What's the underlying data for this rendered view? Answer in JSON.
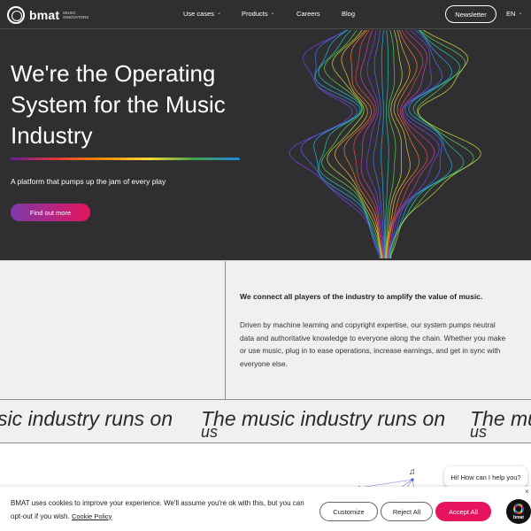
{
  "header": {
    "logo_text": "bmat",
    "logo_sub": "MUSIC INNOVATORS",
    "nav": [
      {
        "label": "Use cases",
        "dropdown": true
      },
      {
        "label": "Products",
        "dropdown": true
      },
      {
        "label": "Careers",
        "dropdown": false
      },
      {
        "label": "Blog",
        "dropdown": false
      }
    ],
    "newsletter_label": "Newsletter",
    "language": "EN"
  },
  "hero": {
    "title": "We're the Operating System for the Music Industry",
    "subtitle": "A platform that pumps up the jam of every play",
    "cta_label": "Find out more"
  },
  "intro": {
    "headline": "We connect all players of the industry to amplify the value of music.",
    "body": "Driven by machine learning and copyright expertise, our system pumps neutral data and authoritative knowledge to everyone along the chain. Whether you make or use music, plug in to ease operations, increase earnings, and get in sync with everyone else."
  },
  "marquee": {
    "fragment_1": "sic industry runs on",
    "fragment_2": "The music industry runs on",
    "fragment_3": "The mu",
    "word_below": "us"
  },
  "chat": {
    "prompt": "Hi! How can I help you?",
    "bot_label": "bmat"
  },
  "cookie": {
    "text": "BMAT uses cookies to improve your experience. We'll assume you're ok with this, but you can opt-out if you wish.",
    "policy_link": "Cookie Policy",
    "customize_label": "Customize",
    "reject_label": "Reject All",
    "accept_label": "Accept All",
    "close_glyph": "×"
  },
  "colors": {
    "dark_bg": "#2f2f31",
    "light_bg": "#f1eff0",
    "accent_pink": "#e6145f",
    "accent_purple": "#7b3aa8"
  }
}
